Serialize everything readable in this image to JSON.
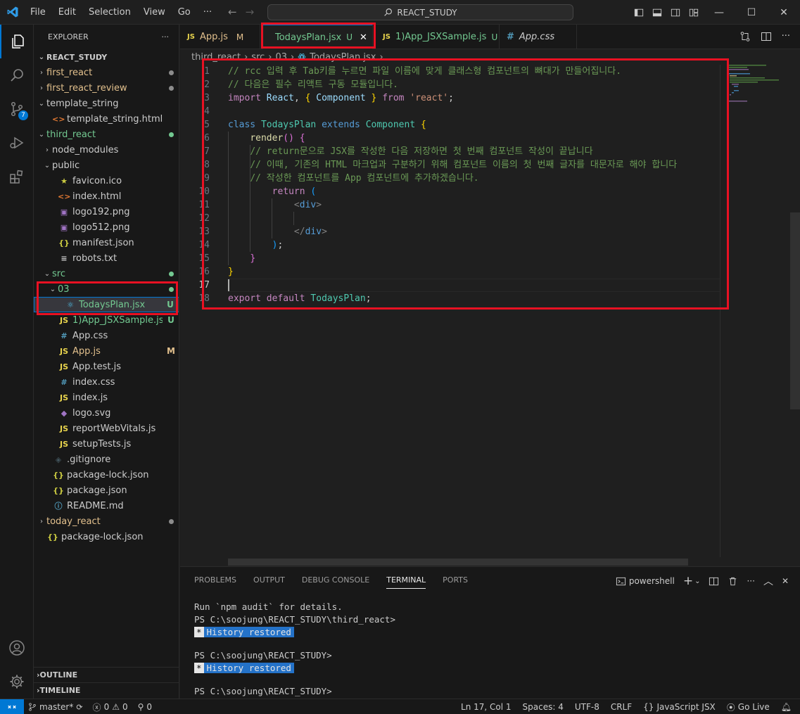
{
  "menu": [
    "File",
    "Edit",
    "Selection",
    "View",
    "Go",
    "···"
  ],
  "search": {
    "text": "REACT_STUDY"
  },
  "activity": {
    "scm_badge": "7"
  },
  "explorer": {
    "title": "EXPLORER",
    "more": "···",
    "root": "REACT_STUDY",
    "outline": "OUTLINE",
    "timeline": "TIMELINE"
  },
  "tree": [
    {
      "label": "first_react",
      "status": "",
      "type": "folder"
    },
    {
      "label": "first_react_review",
      "status": "",
      "type": "folder"
    },
    {
      "label": "template_string",
      "status": "",
      "type": "folder-open"
    },
    {
      "label": "template_string.html",
      "status": "",
      "type": "html"
    },
    {
      "label": "third_react",
      "status": "",
      "type": "folder-open"
    },
    {
      "label": "node_modules",
      "status": "",
      "type": "folder"
    },
    {
      "label": "public",
      "status": "",
      "type": "folder-open"
    },
    {
      "label": "favicon.ico",
      "status": "",
      "type": "star"
    },
    {
      "label": "index.html",
      "status": "",
      "type": "html"
    },
    {
      "label": "logo192.png",
      "status": "",
      "type": "image"
    },
    {
      "label": "logo512.png",
      "status": "",
      "type": "image"
    },
    {
      "label": "manifest.json",
      "status": "",
      "type": "json"
    },
    {
      "label": "robots.txt",
      "status": "",
      "type": "text"
    },
    {
      "label": "src",
      "status": "",
      "type": "folder-open"
    },
    {
      "label": "03",
      "status": "",
      "type": "folder-open"
    },
    {
      "label": "TodaysPlan.jsx",
      "status": "U",
      "type": "react"
    },
    {
      "label": "1)App_JSXSample.js",
      "status": "U",
      "type": "js"
    },
    {
      "label": "App.css",
      "status": "",
      "type": "css"
    },
    {
      "label": "App.js",
      "status": "M",
      "type": "js"
    },
    {
      "label": "App.test.js",
      "status": "",
      "type": "js"
    },
    {
      "label": "index.css",
      "status": "",
      "type": "css"
    },
    {
      "label": "index.js",
      "status": "",
      "type": "js"
    },
    {
      "label": "logo.svg",
      "status": "",
      "type": "svg"
    },
    {
      "label": "reportWebVitals.js",
      "status": "",
      "type": "js"
    },
    {
      "label": "setupTests.js",
      "status": "",
      "type": "js"
    },
    {
      "label": ".gitignore",
      "status": "",
      "type": "git"
    },
    {
      "label": "package-lock.json",
      "status": "",
      "type": "json"
    },
    {
      "label": "package.json",
      "status": "",
      "type": "json"
    },
    {
      "label": "README.md",
      "status": "",
      "type": "info"
    },
    {
      "label": "today_react",
      "status": "",
      "type": "folder"
    },
    {
      "label": "package-lock.json",
      "status": "",
      "type": "json"
    }
  ],
  "tabs": [
    {
      "label": "App.js",
      "icon": "JS",
      "status": "M"
    },
    {
      "label": "TodaysPlan.jsx",
      "icon": "react",
      "status": "U"
    },
    {
      "label": "1)App_JSXSample.js",
      "icon": "JS",
      "status": "U"
    },
    {
      "label": "App.css",
      "icon": "#",
      "status": ""
    }
  ],
  "breadcrumb": [
    "third_react",
    "src",
    "03",
    "TodaysPlan.jsx",
    "..."
  ],
  "code": {
    "l1": "// rcc 입력 후 Tab키를 누르면 파일 이름에 맞게 클래스형 컴포넌트의 뼈대가 만들어집니다.",
    "l2": "// 다음은 필수 리액트 구동 모듈입니다.",
    "l6": "// return문으로 JSX를 작성한 다음 저장하면 첫 번째 컴포넌트 작성이 끝납니다",
    "l7": "// 이때, 기존의 HTML 마크업과 구분하기 위해 컴포넌트 이름의 첫 번째 글자를 대문자로 해야 합니다",
    "l8": "// 작성한 컴포넌트를 App 컴포넌트에 추가하겠습니다."
  },
  "panel": {
    "tabs": [
      "PROBLEMS",
      "OUTPUT",
      "DEBUG CONSOLE",
      "TERMINAL",
      "PORTS"
    ],
    "shell": "powershell",
    "terminal": [
      "Run `npm audit` for details.",
      "PS C:\\soojung\\REACT_STUDY\\third_react>",
      "PS C:\\soojung\\REACT_STUDY>",
      "PS C:\\soojung\\REACT_STUDY>"
    ],
    "history_star": "*",
    "history": "History restored"
  },
  "status": {
    "branch": "master*",
    "errors": "0",
    "warnings": "0",
    "ports": "0",
    "position": "Ln 17, Col 1",
    "spaces": "Spaces: 4",
    "encoding": "UTF-8",
    "eol": "CRLF",
    "language": "JavaScript JSX",
    "golive": "Go Live"
  },
  "colors": {
    "accent": "#0078d4",
    "annotation": "#e81123",
    "untracked": "#73c991",
    "modified": "#e2c08d"
  }
}
